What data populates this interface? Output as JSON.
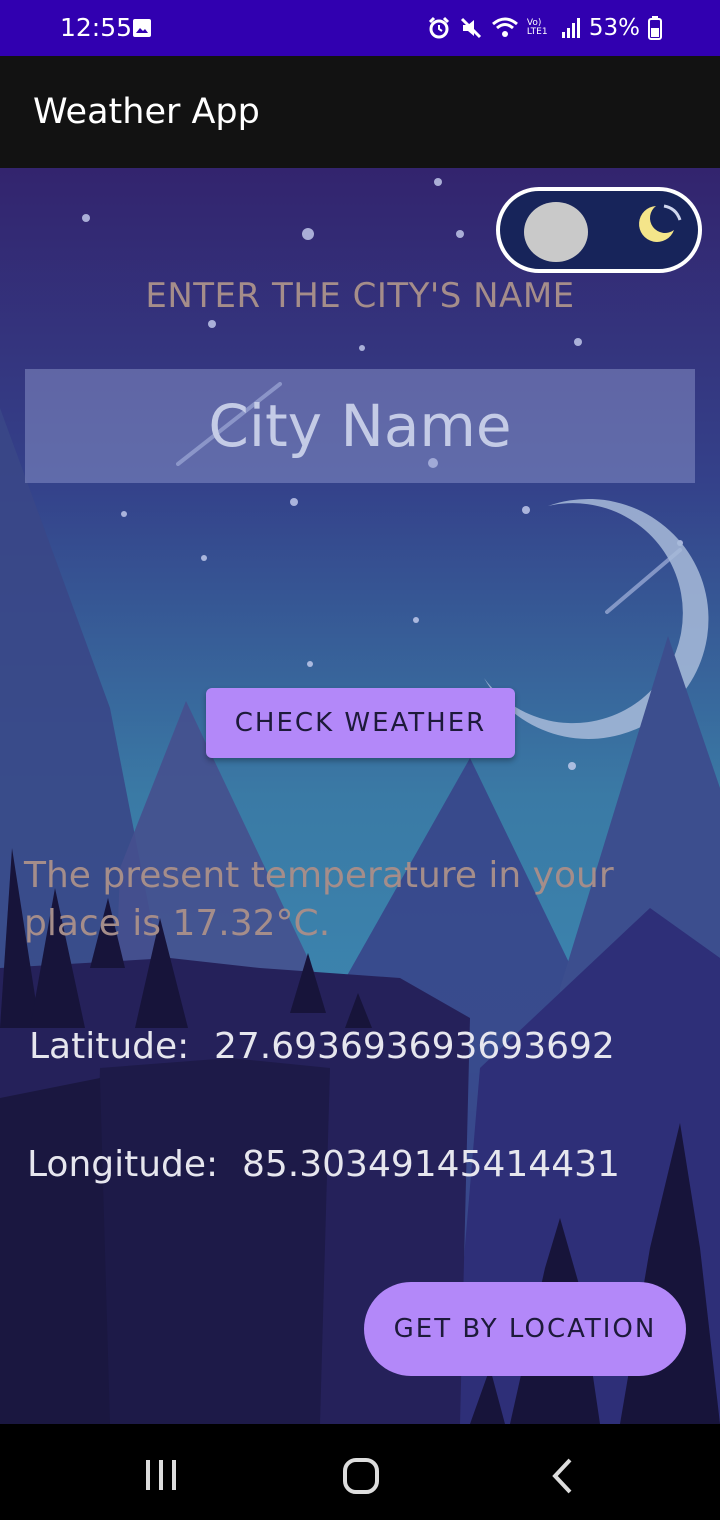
{
  "status_bar": {
    "time": "12:55",
    "signal_text": "Vo) LTE1",
    "battery": "53%"
  },
  "app_bar": {
    "title": "Weather App"
  },
  "theme_toggle": {
    "state": "night",
    "icon": "moon-icon"
  },
  "main": {
    "city_label": "ENTER THE CITY'S NAME",
    "city_input_placeholder": "City Name",
    "check_button": "CHECK WEATHER",
    "temperature_text": "The present temperature in your place is 17.32°C.",
    "latitude_label": "Latitude:",
    "latitude_value": "27.693693693693692",
    "longitude_label": "Longitude:",
    "longitude_value": "85.30349145414431",
    "location_button": "GET BY LOCATION"
  },
  "colors": {
    "status_bar": "#3100b0",
    "app_bar": "#121212",
    "button": "#b388f9",
    "label_text": "#a58d8a"
  }
}
